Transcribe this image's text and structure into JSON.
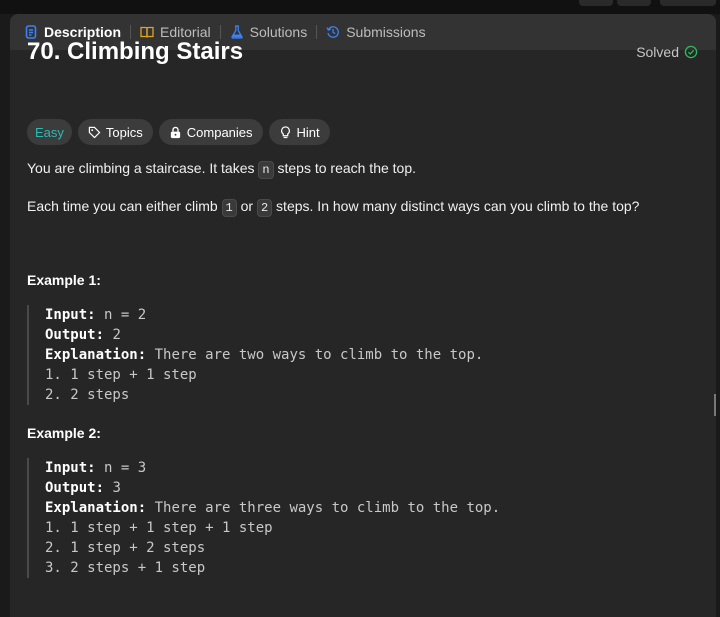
{
  "tabs": [
    {
      "label": "Description",
      "icon": "description-icon",
      "active": true
    },
    {
      "label": "Editorial",
      "icon": "book-icon"
    },
    {
      "label": "Solutions",
      "icon": "flask-icon"
    },
    {
      "label": "Submissions",
      "icon": "history-icon"
    }
  ],
  "problem": {
    "title": "70. Climbing Stairs",
    "status": "Solved"
  },
  "tags": {
    "difficulty": "Easy",
    "topics": "Topics",
    "companies": "Companies",
    "hint": "Hint"
  },
  "description": {
    "p1_a": "You are climbing a staircase. It takes ",
    "p1_code": "n",
    "p1_b": " steps to reach the top.",
    "p2_a": "Each time you can either climb ",
    "p2_code1": "1",
    "p2_b": " or ",
    "p2_code2": "2",
    "p2_c": " steps. In how many distinct ways can you climb to the top?"
  },
  "examples": [
    {
      "title": "Example 1:",
      "input_label": "Input:",
      "input": " n = 2",
      "output_label": "Output:",
      "output": " 2",
      "explanation_label": "Explanation:",
      "explanation": " There are two ways to climb to the top.",
      "lines": [
        "1. 1 step + 1 step",
        "2. 2 steps"
      ]
    },
    {
      "title": "Example 2:",
      "input_label": "Input:",
      "input": " n = 3",
      "output_label": "Output:",
      "output": " 3",
      "explanation_label": "Explanation:",
      "explanation": " There are three ways to climb to the top.",
      "lines": [
        "1. 1 step + 1 step + 1 step",
        "2. 1 step + 2 steps",
        "3. 2 steps + 1 step"
      ]
    }
  ],
  "colors": {
    "accent": "#3b82f6",
    "easy": "#2db8b0",
    "solved": "#2cbb5d",
    "editorial": "#e0a526"
  }
}
